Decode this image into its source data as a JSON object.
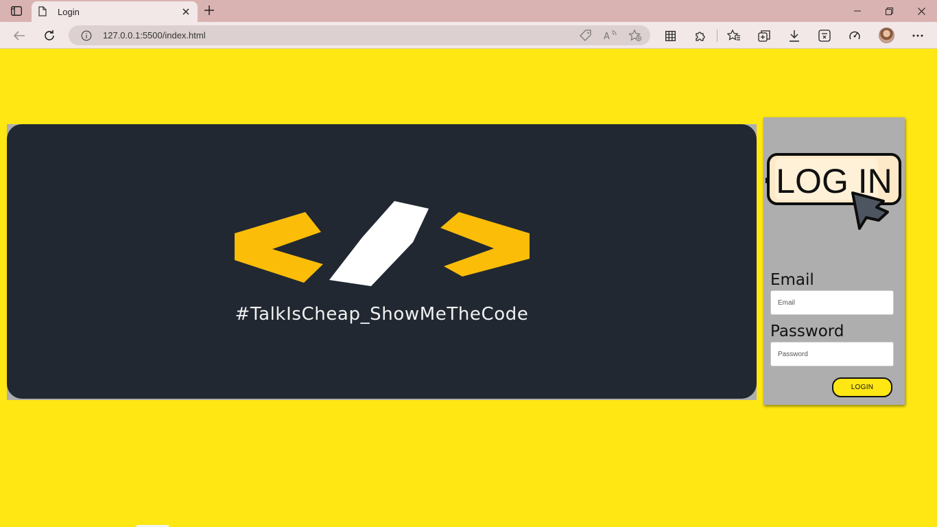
{
  "browser": {
    "tab": {
      "title": "Login",
      "icon": "document-icon"
    },
    "url": "127.0.0.1:5500/index.html"
  },
  "banner": {
    "tagline": "#TalkIsCheap_ShowMeTheCode",
    "logo": "code-brackets-logo",
    "colors": {
      "background": "#212832",
      "brackets": "#fbbd08",
      "slash": "#ffffff"
    }
  },
  "login": {
    "art_text": "LOG IN",
    "email_label": "Email",
    "email_placeholder": "Email",
    "password_label": "Password",
    "password_placeholder": "Password",
    "button_label": "LOGIN"
  },
  "theme": {
    "page_background": "#ffe713",
    "card_background": "#aeaeae"
  }
}
